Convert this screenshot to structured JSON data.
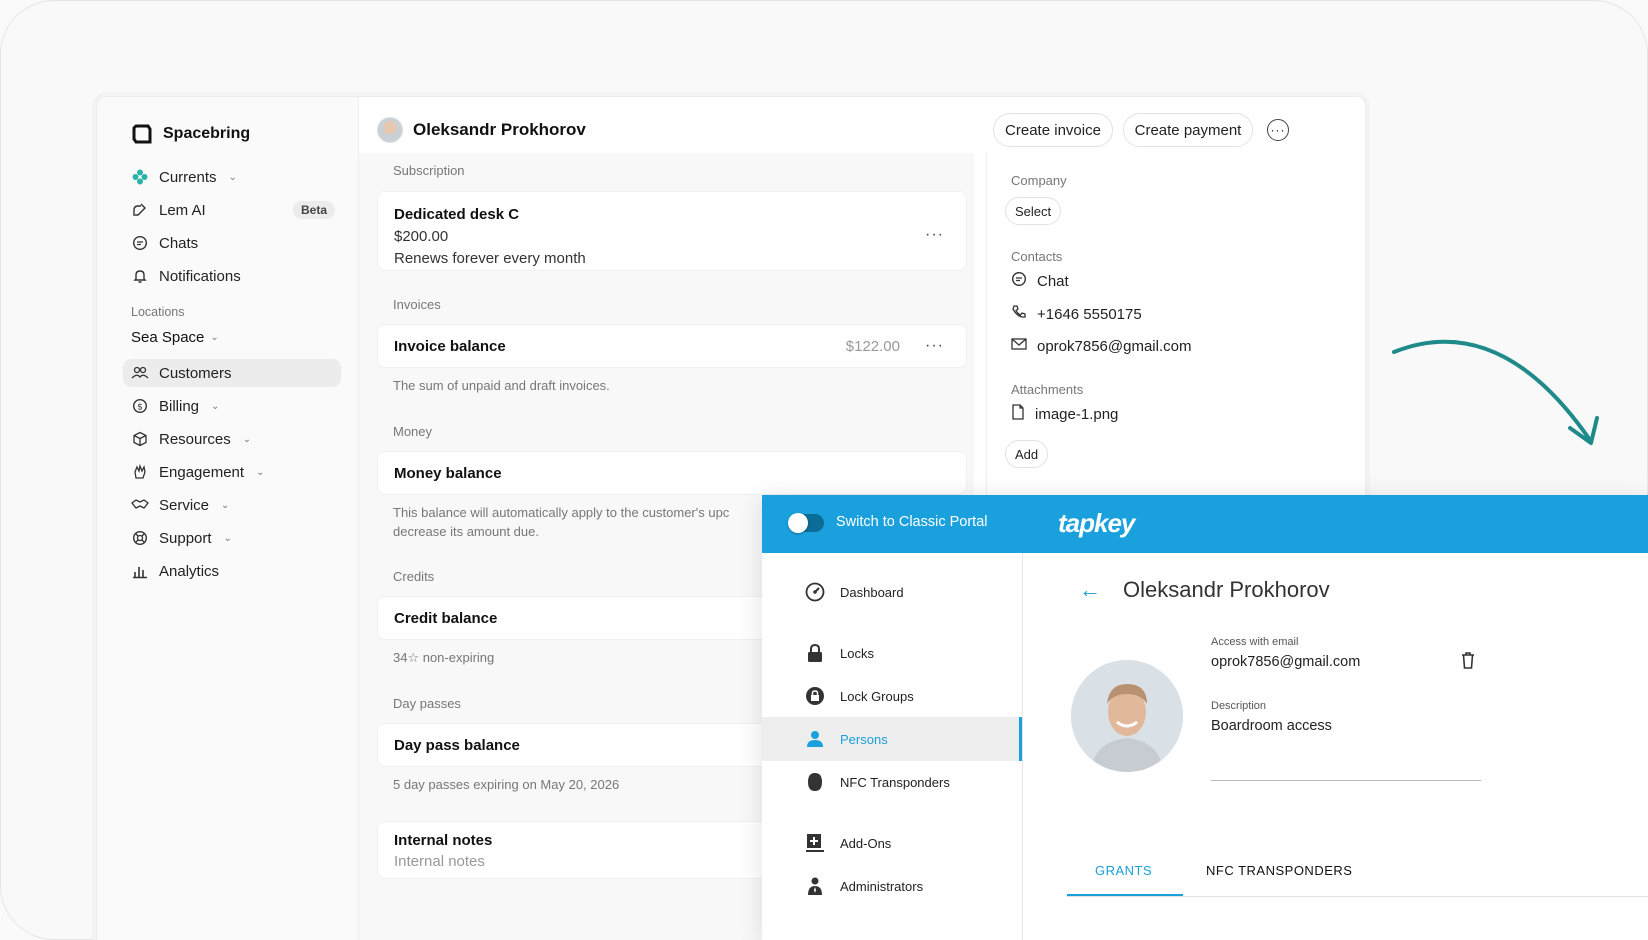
{
  "spacebring": {
    "brand": "Spacebring",
    "nav": [
      {
        "label": "Currents",
        "icon": "currents-icon",
        "chevron": true
      },
      {
        "label": "Lem AI",
        "icon": "lem-ai-icon",
        "badge": "Beta"
      },
      {
        "label": "Chats",
        "icon": "chat-icon"
      },
      {
        "label": "Notifications",
        "icon": "bell-icon"
      }
    ],
    "locations_label": "Locations",
    "location": "Sea Space",
    "nav2": [
      {
        "label": "Customers",
        "icon": "customers-icon",
        "active": true
      },
      {
        "label": "Billing",
        "icon": "billing-icon",
        "chevron": true
      },
      {
        "label": "Resources",
        "icon": "cube-icon",
        "chevron": true
      },
      {
        "label": "Engagement",
        "icon": "engagement-icon",
        "chevron": true
      },
      {
        "label": "Service",
        "icon": "handshake-icon",
        "chevron": true
      },
      {
        "label": "Support",
        "icon": "lifebuoy-icon",
        "chevron": true
      },
      {
        "label": "Analytics",
        "icon": "analytics-icon"
      }
    ],
    "customer": {
      "name": "Oleksandr Prokhorov",
      "create_invoice": "Create invoice",
      "create_payment": "Create payment",
      "subscription_label": "Subscription",
      "subscription": {
        "title": "Dedicated desk C",
        "price": "$200.00",
        "renew": "Renews forever every month"
      },
      "invoices_label": "Invoices",
      "invoice_title": "Invoice balance",
      "invoice_amount": "$122.00",
      "invoice_note": "The sum of unpaid and draft invoices.",
      "money_label": "Money",
      "money_title": "Money balance",
      "money_note_1": "This balance will automatically apply to the customer's upc",
      "money_note_2": "decrease its amount due.",
      "credits_label": "Credits",
      "credit_title": "Credit balance",
      "credit_note": "34☆ non-expiring",
      "daypass_label": "Day passes",
      "daypass_title": "Day pass balance",
      "daypass_note": "5 day passes expiring on May 20, 2026",
      "notes_title": "Internal notes",
      "notes_placeholder": "Internal notes",
      "company_label": "Company",
      "company_select": "Select",
      "contacts_label": "Contacts",
      "contact_chat": "Chat",
      "contact_phone": "+1646 5550175",
      "contact_email": "oprok7856@gmail.com",
      "attachments_label": "Attachments",
      "attachment_file": "image-1.png",
      "attachment_add": "Add"
    }
  },
  "tapkey": {
    "switch_label": "Switch to Classic Portal",
    "logo": "tapkey",
    "nav": [
      {
        "label": "Dashboard",
        "icon": "dashboard-icon"
      },
      {
        "label": "Locks",
        "icon": "lock-icon"
      },
      {
        "label": "Lock Groups",
        "icon": "lock-groups-icon"
      },
      {
        "label": "Persons",
        "icon": "person-icon",
        "active": true
      },
      {
        "label": "NFC Transponders",
        "icon": "nfc-icon"
      },
      {
        "label": "Add-Ons",
        "icon": "add-ons-icon"
      },
      {
        "label": "Administrators",
        "icon": "administrators-icon"
      }
    ],
    "person_name": "Oleksandr Prokhorov",
    "access_label": "Access with email",
    "access_email": "oprok7856@gmail.com",
    "description_label": "Description",
    "description_value": "Boardroom access",
    "tabs": [
      "GRANTS",
      "NFC TRANSPONDERS"
    ],
    "accent": "#1aa0dc"
  },
  "colors": {
    "teal_arrow": "#1f8a8a",
    "tapkey_blue": "#1aa0dc"
  }
}
